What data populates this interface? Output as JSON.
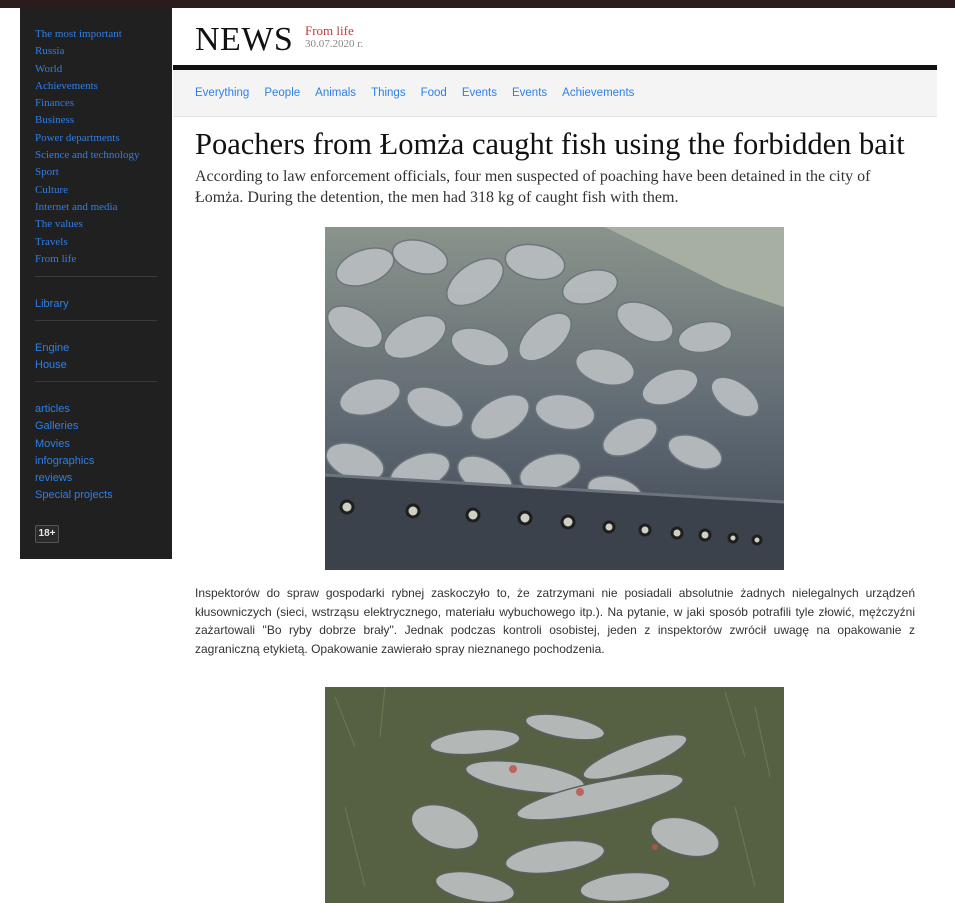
{
  "sidebar": {
    "primary": [
      {
        "label": "The most important"
      },
      {
        "label": "Russia"
      },
      {
        "label": "World"
      },
      {
        "label": "Achievements"
      },
      {
        "label": "Finances"
      },
      {
        "label": "Business"
      },
      {
        "label": "Power departments"
      },
      {
        "label": "Science and technology"
      },
      {
        "label": "Sport"
      },
      {
        "label": "Culture"
      },
      {
        "label": "Internet and media"
      },
      {
        "label": "The values"
      },
      {
        "label": "Travels"
      },
      {
        "label": "From life"
      }
    ],
    "library": "Library",
    "secondary": [
      {
        "label": "Engine"
      },
      {
        "label": "House"
      }
    ],
    "tertiary": [
      {
        "label": "articles"
      },
      {
        "label": "Galleries"
      },
      {
        "label": "Movies"
      },
      {
        "label": "infographics"
      },
      {
        "label": "reviews"
      },
      {
        "label": "Special projects"
      }
    ],
    "age_badge": "18+"
  },
  "header": {
    "logo": "NEWS",
    "section": "From life",
    "date": "30.07.2020 г."
  },
  "tabs": [
    "Everything",
    "People",
    "Animals",
    "Things",
    "Food",
    "Events",
    "Events",
    "Achievements"
  ],
  "article": {
    "headline": "Poachers from Łomża caught fish using the forbidden bait",
    "lead": "According to law enforcement officials, four men suspected of poaching have been detained in the city of Łomża. During the detention, the men had 318 kg of caught fish with them.",
    "body": "Inspektorów do spraw gospodarki rybnej zaskoczyło to, że zatrzymani nie posiadali absolutnie żadnych nielegalnych urządzeń kłusowniczych (sieci, wstrząsu elektrycznego, materiału wybuchowego itp.). Na pytanie, w jaki sposób potrafili tyle złowić, mężczyźni zażartowali \"Bo ryby dobrze brały\". Jednak podczas kontroli osobistej, jeden z inspektorów zwrócił uwagę na opakowanie z zagraniczną etykietą. Opakowanie zawierało spray nieznanego pochodzenia."
  },
  "colors": {
    "link": "#2f7fe8",
    "sidebar_bg": "#202020",
    "section_red": "#c33a3a",
    "top_strip": "#2b1b1d"
  }
}
